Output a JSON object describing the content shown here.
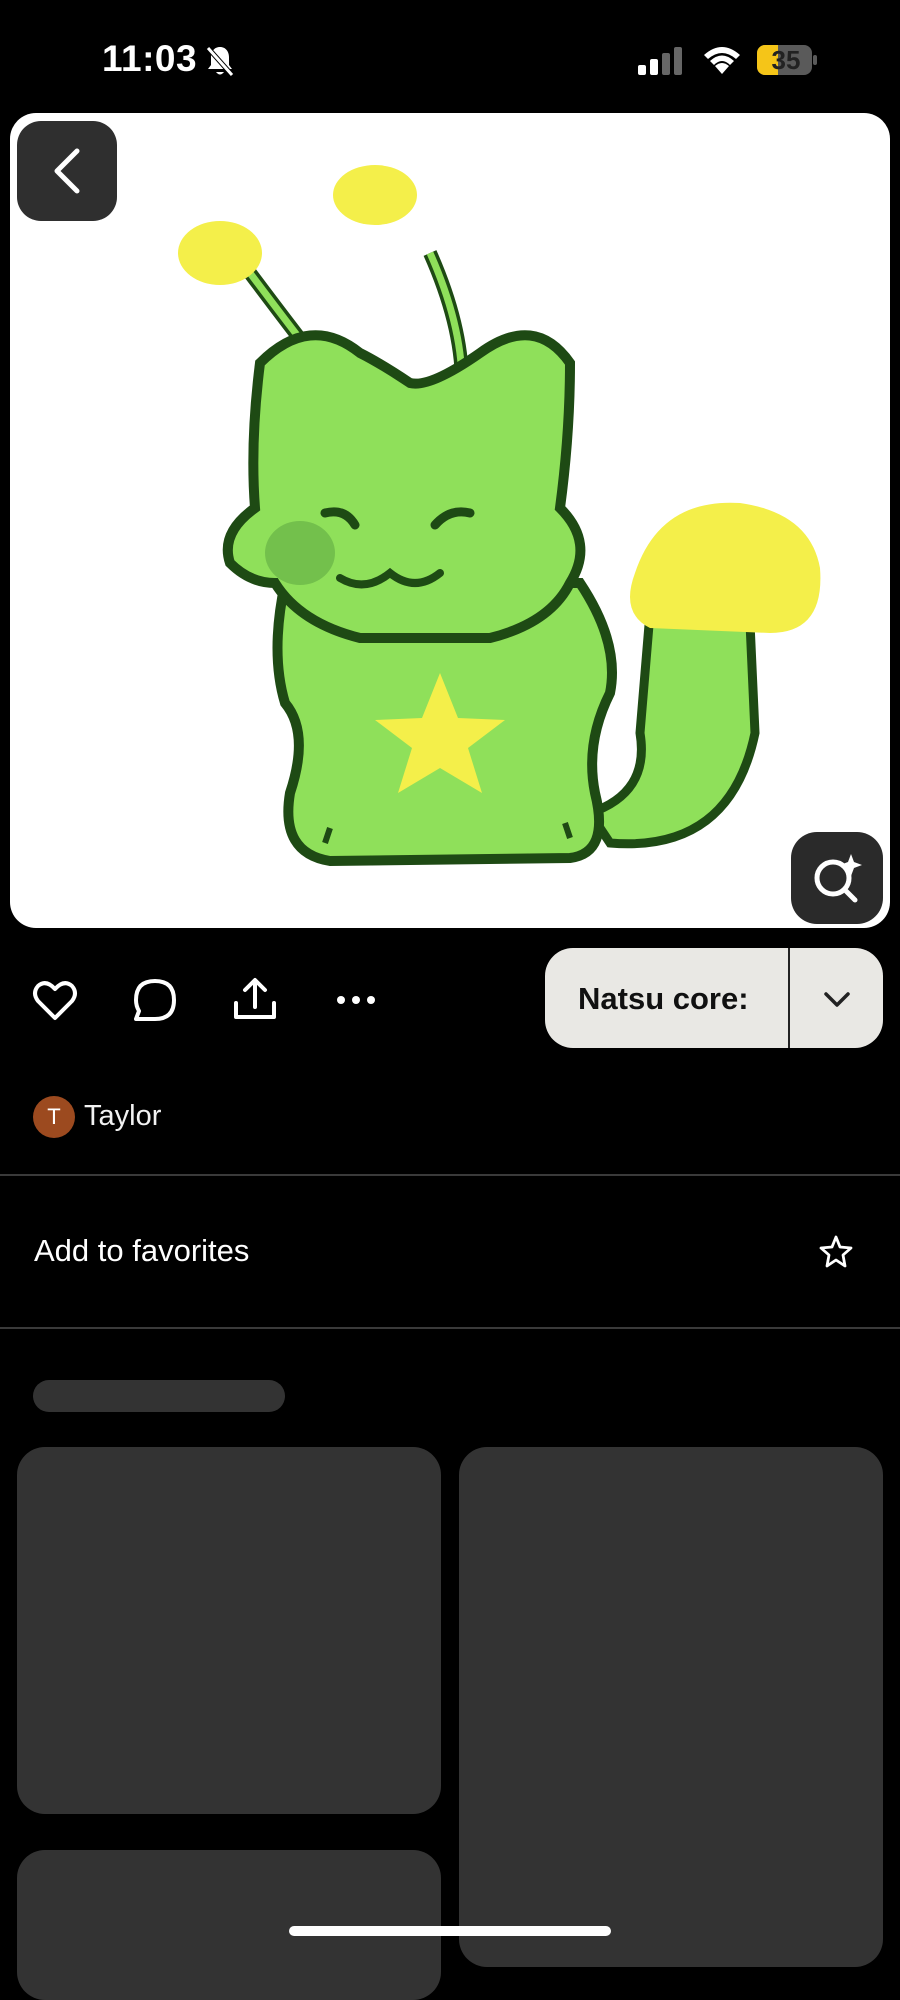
{
  "status_bar": {
    "time": "11:03",
    "battery_level": "35",
    "icons": [
      "bell-slash-icon",
      "cellular-signal-icon",
      "wifi-icon",
      "battery-icon"
    ]
  },
  "pin": {
    "image_alt": "green cat creature illustration",
    "save_board_label": "Natsu core:",
    "actions": [
      "heart-icon",
      "comment-icon",
      "share-icon",
      "more-icon"
    ]
  },
  "author": {
    "initial": "T",
    "name": "Taylor"
  },
  "favorites": {
    "label": "Add to favorites"
  },
  "colors": {
    "background": "#000000",
    "placeholder": "#333333",
    "pill": "#e9e8e4",
    "avatar": "#9c4a1f",
    "creature_green": "#8fe05a",
    "creature_yellow": "#f4ef4a",
    "outline": "#1e4a14"
  }
}
